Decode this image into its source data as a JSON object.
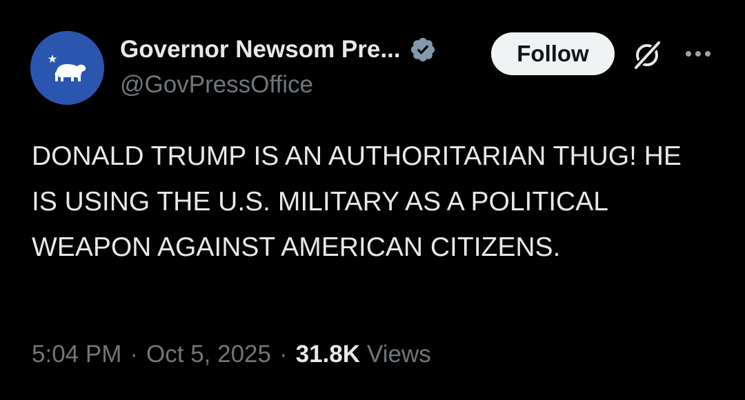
{
  "author": {
    "display_name": "Governor Newsom Pre...",
    "handle": "@GovPressOffice",
    "avatar_icon": "california-bear-icon",
    "avatar_color": "#2a56b0",
    "verified_icon": "verified-badge-icon",
    "verified_color": "#829aab"
  },
  "actions": {
    "follow_label": "Follow",
    "grok_icon": "grok-icon",
    "more_icon": "more-icon"
  },
  "tweet": {
    "text": "DONALD TRUMP IS AN AUTHORITARIAN THUG! HE IS USING THE U.S. MILITARY AS A POLITICAL WEAPON AGAINST AMERICAN CITIZENS."
  },
  "meta": {
    "time": "5:04 PM",
    "separator": "·",
    "date": "Oct 5, 2025",
    "views_count": "31.8K",
    "views_label": "Views"
  },
  "colors": {
    "background": "#000000",
    "primary_text": "#e7e9ea",
    "secondary_text": "#71767b",
    "follow_bg": "#eff3f4"
  }
}
